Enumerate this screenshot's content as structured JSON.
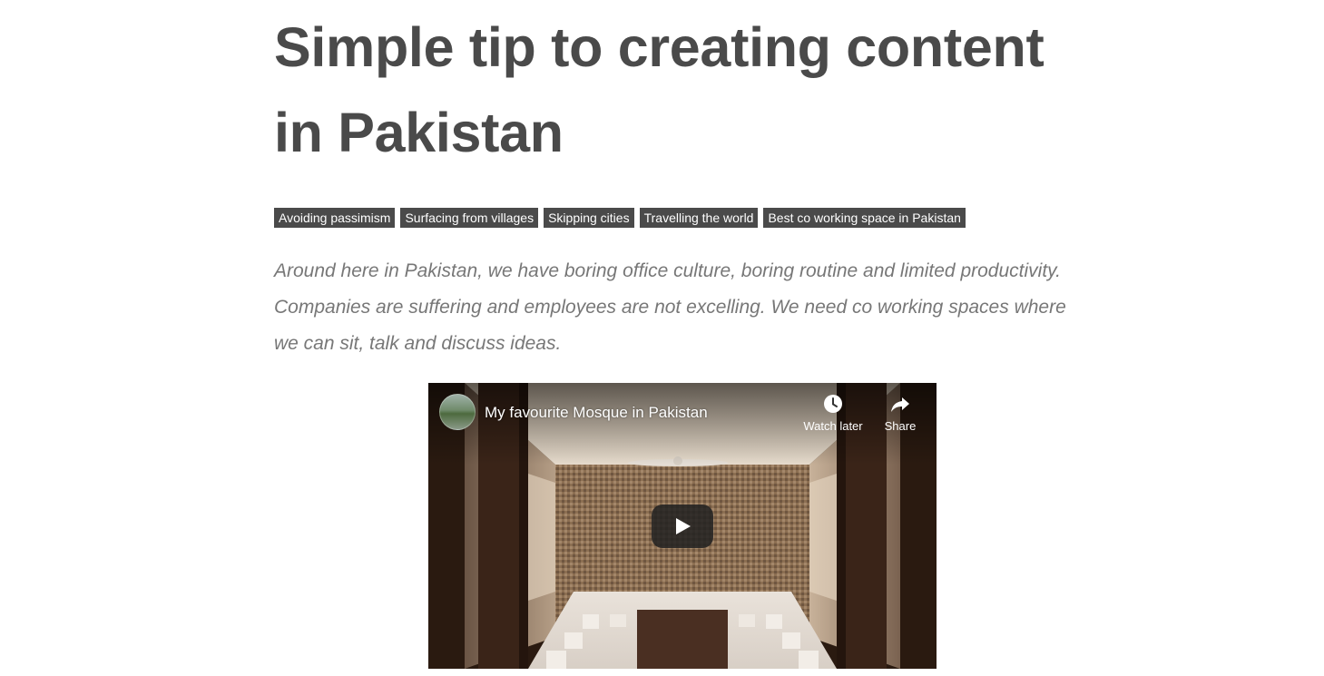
{
  "article": {
    "title": "Simple tip to creating content in Pakistan",
    "tags": [
      "Avoiding passimism",
      "Surfacing from villages",
      "Skipping cities",
      "Travelling the world",
      "Best co working space in Pakistan"
    ],
    "lead": "Around here in Pakistan, we have boring office culture, boring routine and limited productivity. Companies are suffering and employees are not excelling. We need co working spaces where we can sit, talk and discuss ideas."
  },
  "video": {
    "title": "My favourite Mosque in Pakistan",
    "watch_later_label": "Watch later",
    "share_label": "Share",
    "icons": {
      "watch_later": "clock-icon",
      "share": "share-arrow-icon",
      "play": "play-icon",
      "channel": "channel-avatar"
    }
  },
  "colors": {
    "text_dark": "#4a4a4a",
    "text_lead": "#777777",
    "tag_bg": "#4a4a4a",
    "tag_text": "#ffffff"
  }
}
